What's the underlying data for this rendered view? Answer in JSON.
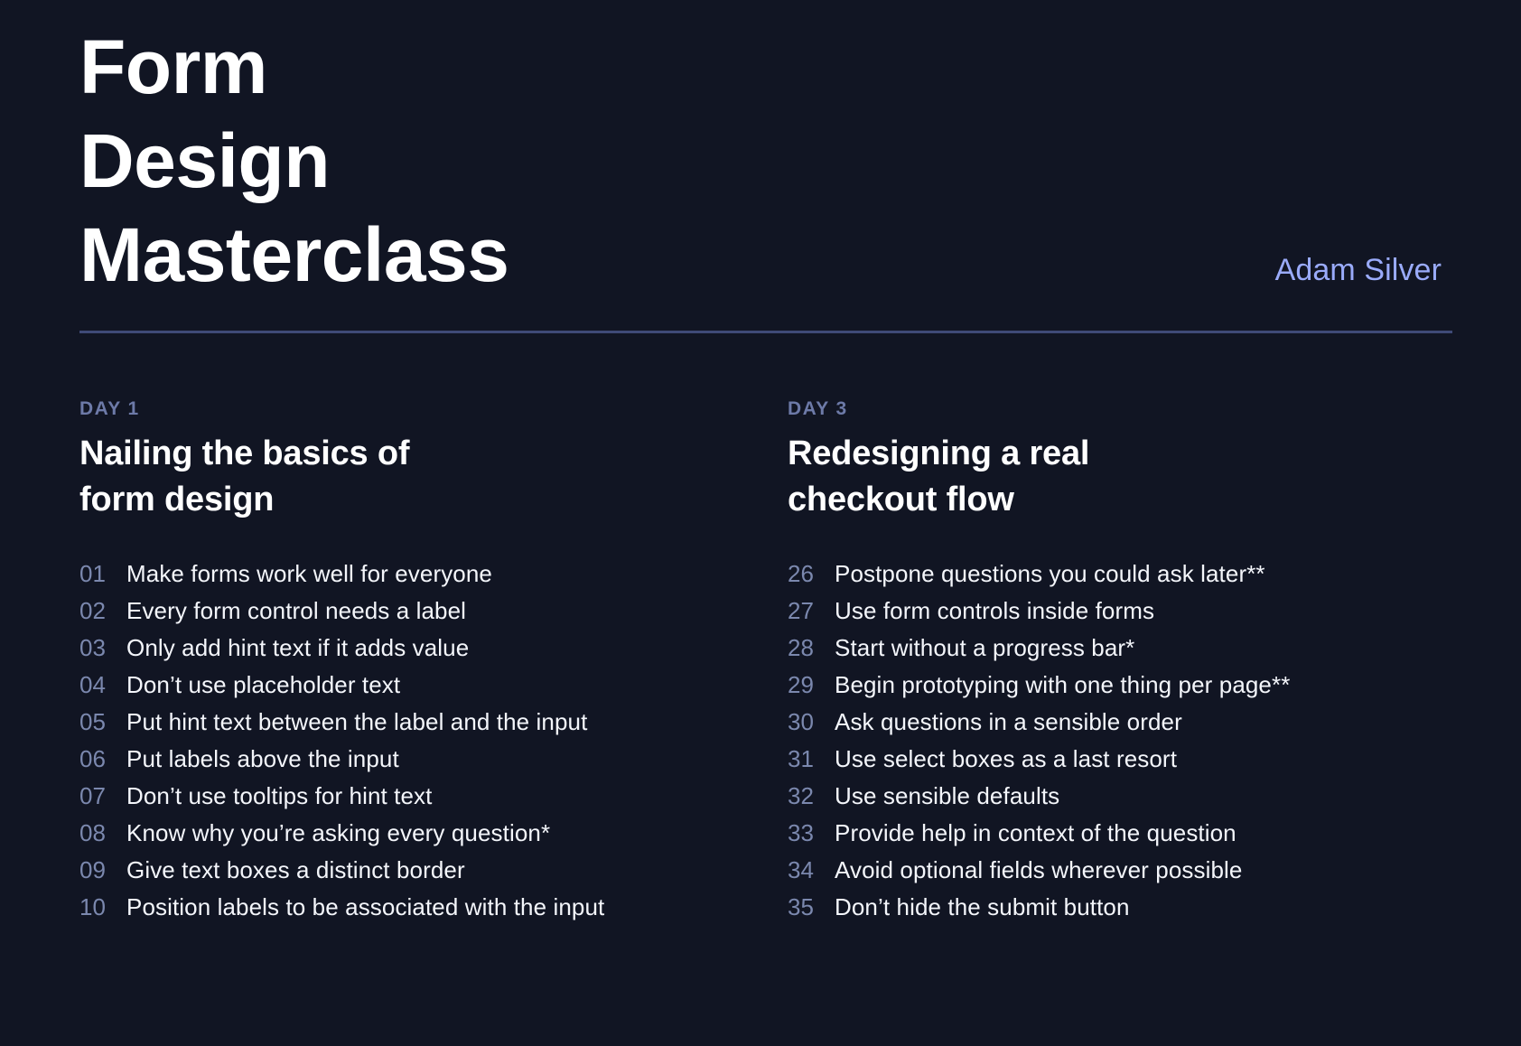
{
  "theme": {
    "background": "#111523",
    "title_color": "#ffffff",
    "author_color": "#9aabfa",
    "divider_color": "#3f4a77",
    "day_label_color": "#6d7aa8",
    "lesson_number_color": "#7b88ae",
    "lesson_text_color": "#f4f6fb"
  },
  "header": {
    "title": "Form\nDesign\nMasterclass",
    "author": "Adam Silver"
  },
  "columns": [
    {
      "day_label": "DAY 1",
      "day_title": "Nailing the basics of\nform design",
      "lessons": [
        {
          "number": "01",
          "text": "Make forms work well for everyone"
        },
        {
          "number": "02",
          "text": "Every form control needs a label"
        },
        {
          "number": "03",
          "text": "Only add hint text if it adds value"
        },
        {
          "number": "04",
          "text": "Don’t use placeholder text"
        },
        {
          "number": "05",
          "text": "Put hint text between the label and the input"
        },
        {
          "number": "06",
          "text": "Put labels above the input"
        },
        {
          "number": "07",
          "text": "Don’t use tooltips for hint text"
        },
        {
          "number": "08",
          "text": "Know why you’re asking every question*"
        },
        {
          "number": "09",
          "text": "Give text boxes a distinct border"
        },
        {
          "number": "10",
          "text": "Position labels to be associated with the input"
        }
      ]
    },
    {
      "day_label": "DAY 3",
      "day_title": "Redesigning a real\ncheckout flow",
      "lessons": [
        {
          "number": "26",
          "text": "Postpone questions you could ask later**"
        },
        {
          "number": "27",
          "text": "Use form controls inside forms"
        },
        {
          "number": "28",
          "text": "Start without a progress bar*"
        },
        {
          "number": "29",
          "text": "Begin prototyping with one thing per page**"
        },
        {
          "number": "30",
          "text": "Ask questions in a sensible order"
        },
        {
          "number": "31",
          "text": "Use select boxes as a last resort"
        },
        {
          "number": "32",
          "text": "Use sensible defaults"
        },
        {
          "number": "33",
          "text": "Provide help in context of the question"
        },
        {
          "number": "34",
          "text": "Avoid optional fields wherever possible"
        },
        {
          "number": "35",
          "text": "Don’t hide the submit button"
        }
      ]
    }
  ]
}
